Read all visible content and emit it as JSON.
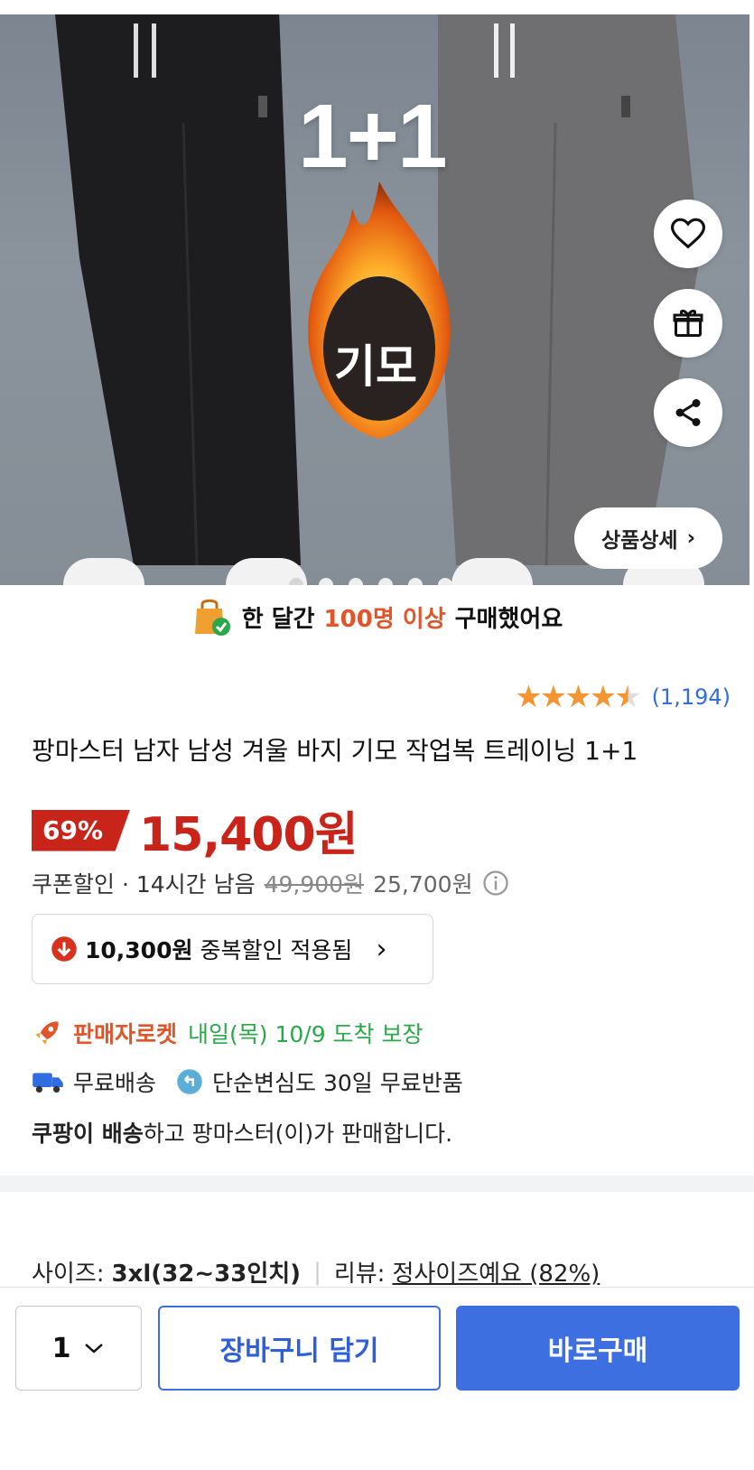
{
  "hero": {
    "title": "1+1",
    "badge_text": "기모",
    "detail_button": "상품상세",
    "dots_count": 6,
    "active_dot": 0
  },
  "purchase_badge": {
    "prefix": "한 달간",
    "highlight": "100명 이상",
    "suffix": "구매했어요"
  },
  "rating": {
    "stars": 4.5,
    "count": "(1,194)"
  },
  "product": {
    "title": "팡마스터 남자 남성 겨울 바지 기모 작업복 트레이닝 1+1"
  },
  "price": {
    "discount": "69%",
    "final": "15,400원"
  },
  "coupon": {
    "label": "쿠폰할인 · 14시간 남음",
    "original": "49,900원",
    "now": "25,700원"
  },
  "dup_discount": {
    "amount": "10,300원",
    "text": "중복할인 적용됨"
  },
  "delivery": {
    "brand": "판매자로켓",
    "eta": "내일(목) 10/9 도착 보장",
    "free_shipping": "무료배송",
    "return_policy": "단순변심도 30일 무료반품"
  },
  "seller": {
    "bold": "쿠팡이 배송",
    "rest": "하고 팡마스터(이)가 판매합니다."
  },
  "size": {
    "label": "사이즈:",
    "value": "3xl(32~33인치)",
    "review_label": "리뷰:",
    "review_value": "정사이즈예요 (82%)"
  },
  "bottom_bar": {
    "quantity": "1",
    "cart_label": "장바구니 담기",
    "buy_label": "바로구매"
  },
  "colors": {
    "accent_blue": "#3d6fe0",
    "price_red": "#c9241a",
    "highlight_orange": "#e0552a",
    "delivery_green": "#2aa84a",
    "star_orange": "#f59432"
  }
}
